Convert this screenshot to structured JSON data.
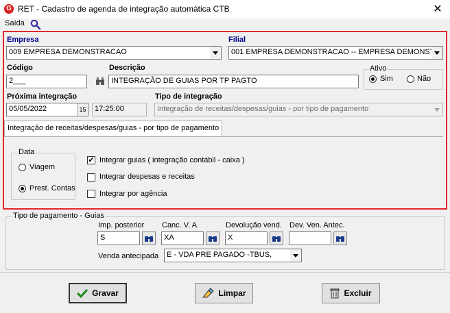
{
  "window": {
    "title": "RET - Cadastro de agenda de integração automática CTB",
    "close": "✕",
    "app_icon": "G"
  },
  "menu": {
    "saida": "Saída",
    "search_icon": "search-icon"
  },
  "empresa": {
    "label": "Empresa",
    "value": "009 EMPRESA DEMONSTRACAO"
  },
  "filial": {
    "label": "Filial",
    "value": "001 EMPRESA DEMONSTRACAO -- EMPRESA DEMONSTF"
  },
  "codigo": {
    "label": "Código",
    "value": "2___"
  },
  "descricao": {
    "label": "Descrição",
    "value": "INTEGRAÇÃO DE GUIAS POR TP PAGTO"
  },
  "ativo": {
    "label": "Ativo",
    "sim": "Sim",
    "nao": "Não",
    "selected": "Sim"
  },
  "proxima": {
    "label": "Próxima integração",
    "date": "05/05/2022",
    "cal": "15",
    "time": "17:25:00"
  },
  "tipo_integracao": {
    "label": "Tipo de integração",
    "value": "Integração de receitas/despesas/guias - por tipo de pagamento"
  },
  "tab": {
    "label": "Integração de receitas/despesas/guias - por tipo de pagamento"
  },
  "data_group": {
    "legend": "Data",
    "viagem": "Viagem",
    "prest": "Prest. Contas",
    "selected": "Prest. Contas"
  },
  "checks": [
    {
      "label": "Integrar guias ( integração contábil - caixa )",
      "checked": true
    },
    {
      "label": "Integrar despesas e receitas",
      "checked": false
    },
    {
      "label": "Integrar por agência",
      "checked": false
    }
  ],
  "tipo_pagamento": {
    "legend": "Tipo de pagamento - Guias",
    "imp_label": "Imp. posterior",
    "imp_value": "S",
    "canc_label": "Canc. V. A.",
    "canc_value": "XA",
    "dev_label": "Devolução vend.",
    "dev_value": "X",
    "devant_label": "Dev. Ven. Antec.",
    "devant_value": "",
    "venda_label": "Venda antecipada",
    "venda_value": "E  -  VDA PRE PAGADO -TBUS,"
  },
  "buttons": {
    "gravar": "Gravar",
    "limpar": "Limpar",
    "excluir": "Excluir"
  },
  "colors": {
    "highlight_border": "#e0282d",
    "label_blue": "#00008b"
  }
}
